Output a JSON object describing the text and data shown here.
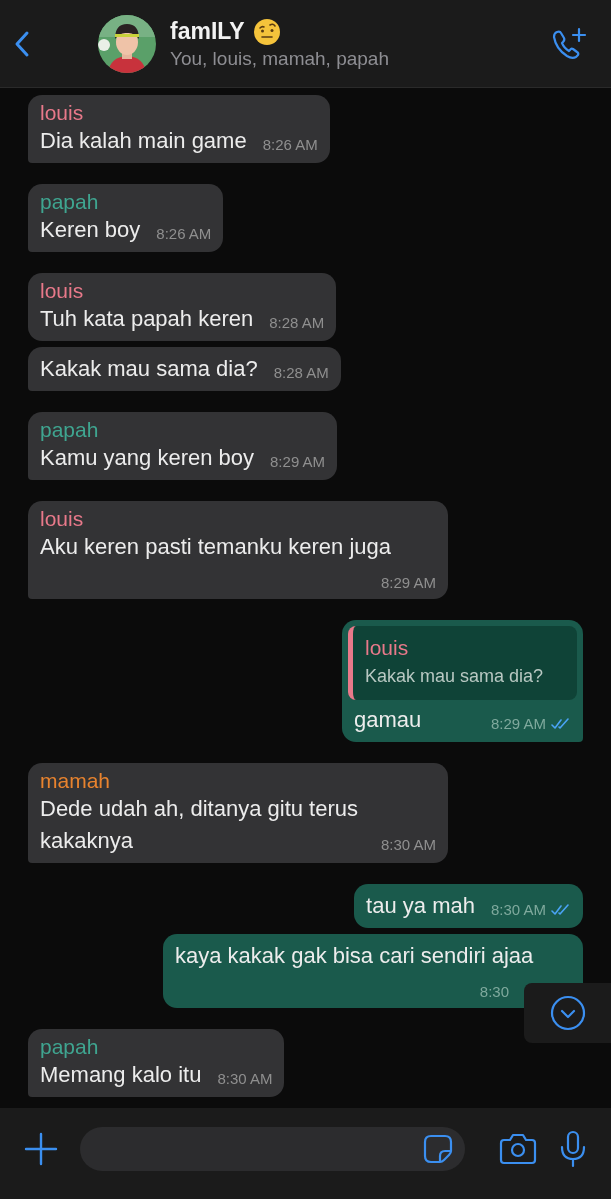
{
  "header": {
    "title": "famILY",
    "members": "You, louis, mamah, papah"
  },
  "messages": [
    {
      "kind": "incoming",
      "sender": "louis",
      "color": "#e8798a",
      "text": "Dia kalah main game",
      "time": "8:26 AM"
    },
    {
      "kind": "incoming",
      "sender": "papah",
      "color": "#3fa590",
      "text": "Keren boy",
      "time": "8:26 AM"
    },
    {
      "kind": "incoming",
      "sender": "louis",
      "color": "#e8798a",
      "text": "Tuh kata papah keren",
      "time": "8:28 AM"
    },
    {
      "kind": "incoming",
      "text": "Kakak mau sama dia?",
      "time": "8:28 AM"
    },
    {
      "kind": "incoming",
      "sender": "papah",
      "color": "#3fa590",
      "text": "Kamu yang keren boy",
      "time": "8:29 AM"
    },
    {
      "kind": "incoming",
      "sender": "louis",
      "color": "#e8798a",
      "text": "Aku keren pasti temanku keren juga",
      "time": "8:29 AM"
    },
    {
      "kind": "outgoing",
      "quote": {
        "sender": "louis",
        "color": "#e8798a",
        "text": "Kakak mau sama dia?"
      },
      "text": "gamau",
      "time": "8:29 AM",
      "read": true
    },
    {
      "kind": "incoming",
      "sender": "mamah",
      "color": "#e8832e",
      "text": "Dede udah ah, ditanya gitu terus kakaknya",
      "time": "8:30 AM"
    },
    {
      "kind": "outgoing",
      "text": "tau ya mah",
      "time": "8:30 AM",
      "read": true
    },
    {
      "kind": "outgoing",
      "text": "kaya kakak gak bisa cari sendiri ajaa",
      "time": "8:30"
    },
    {
      "kind": "incoming",
      "sender": "papah",
      "color": "#3fa590",
      "text": "Memang kalo itu",
      "time": "8:30 AM"
    }
  ]
}
